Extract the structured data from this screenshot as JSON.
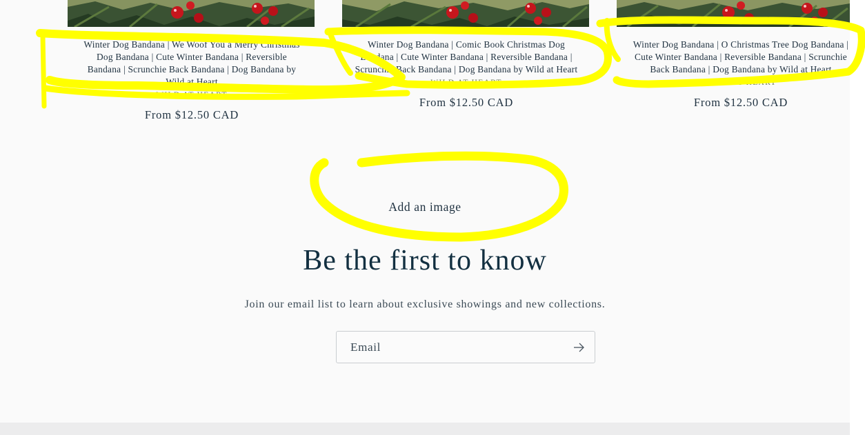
{
  "products": [
    {
      "title_lines": [
        "Winter Dog Bandana | We Woof You a Merry Christmas",
        "Dog Bandana | Cute Winter Bandana | Reversible",
        "Bandana | Scrunchie Back Bandana | Dog Bandana by",
        "Wild at Heart"
      ],
      "vendor": "WILD AT HEART",
      "price": "From $12.50 CAD"
    },
    {
      "title_lines": [
        "Winter Dog Bandana | Comic Book Christmas Dog",
        "Bandana | Cute Winter Bandana | Reversible Bandana |",
        "Scrunchie Back Bandana | Dog Bandana by Wild at Heart"
      ],
      "vendor": "WILD AT HEART",
      "price": "From $12.50 CAD"
    },
    {
      "title_lines": [
        "Winter Dog Bandana | O Christmas Tree Dog Bandana |",
        "Cute Winter Bandana | Reversible Bandana | Scrunchie",
        "Back Bandana | Dog Bandana by Wild at Heart"
      ],
      "vendor": "WILD AT HEART",
      "price": "From $12.50 CAD"
    }
  ],
  "image_placeholder": {
    "label": "Add an image"
  },
  "newsletter": {
    "heading": "Be the first to know",
    "subtext": "Join our email list to learn about exclusive showings and new collections.",
    "email_placeholder": "Email",
    "submit_icon": "arrow-right-icon"
  },
  "colors": {
    "background": "#fafafa",
    "text": "#1f3140",
    "vendor_text": "#6d7b52",
    "highlight": "#ffff00",
    "footer_band": "#ececed"
  }
}
